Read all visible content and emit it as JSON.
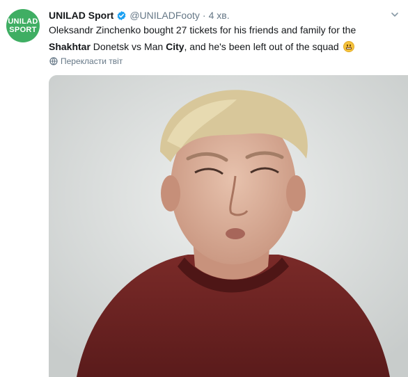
{
  "account": {
    "avatar_line1": "UNILAD",
    "avatar_line2": "SPORT",
    "name": "UNILAD Sport",
    "handle": "@UNILADFooty",
    "separator": "·",
    "time": "4 хв."
  },
  "tweet": {
    "text_part1": "Oleksandr Zinchenko bought 27 tickets for his friends and family for the ",
    "hashtag_shakhtar": "Shakhtar",
    "text_part2": " Donetsk vs Man ",
    "hashtag_city": "City",
    "text_part3": ", and he's been left out of the squad"
  },
  "translate_label": "Перекласти твіт",
  "colors": {
    "brand_green": "#3fae63",
    "verified_blue": "#1da1f2",
    "muted_gray": "#657786"
  },
  "icons": {
    "verified": "verified-badge-icon",
    "menu": "chevron-down-icon",
    "translate": "globe-icon",
    "emoji": "grimacing-face-emoji"
  }
}
